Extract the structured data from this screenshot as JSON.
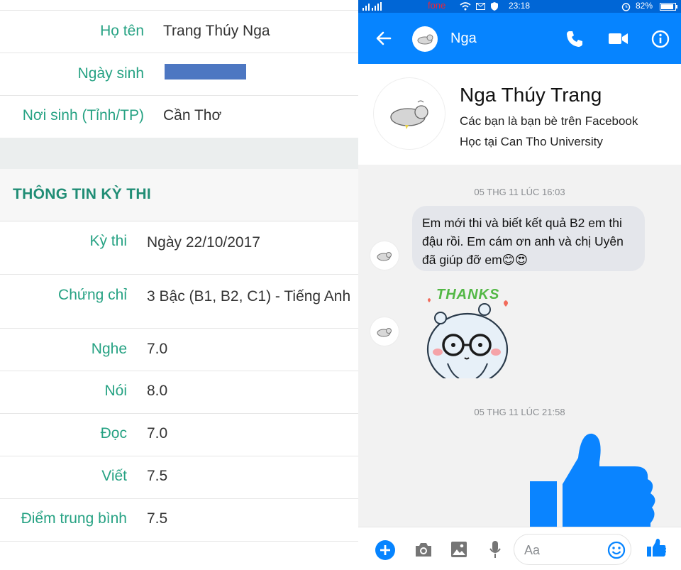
{
  "profile": {
    "rows": [
      {
        "label": "Họ tên",
        "value": "Trang Thúy Nga"
      },
      {
        "label": "Ngày sinh",
        "value": ""
      },
      {
        "label": "Nơi sinh (Tỉnh/TP)",
        "value": "Cần Thơ"
      }
    ]
  },
  "exam": {
    "section_title": "THÔNG TIN KỲ THI",
    "rows": [
      {
        "label": "Kỳ thi",
        "value": "Ngày 22/10/2017"
      },
      {
        "label": "Chứng chỉ",
        "value": "3 Bậc (B1, B2, C1) - Tiếng Anh"
      },
      {
        "label": "Nghe",
        "value": "7.0"
      },
      {
        "label": "Nói",
        "value": "8.0"
      },
      {
        "label": "Đọc",
        "value": "7.0"
      },
      {
        "label": "Viết",
        "value": "7.5"
      },
      {
        "label": "Điểm trung bình",
        "value": "7.5"
      }
    ]
  },
  "statusbar": {
    "carrier": "fone",
    "time": "23:18",
    "battery": "82%"
  },
  "chat": {
    "contact_name": "Nga",
    "header_name": "Nga Thúy Trang",
    "header_line1": "Các bạn là bạn bè trên Facebook",
    "header_line2": "Học tại Can Tho University",
    "timestamp1": "05 THG 11 LÚC 16:03",
    "message": "Em mới thi và biết kết quả B2 em thi đậu rồi. Em cám ơn anh và chị Uyên đã giúp đỡ em😊😍",
    "sticker_text": "THANKS",
    "timestamp2": "05 THG 11 LÚC 21:58",
    "composer_placeholder": "Aa"
  },
  "colors": {
    "label_green": "#26a283",
    "messenger_blue": "#0684ff",
    "redaction_blue": "#4d77c2"
  }
}
